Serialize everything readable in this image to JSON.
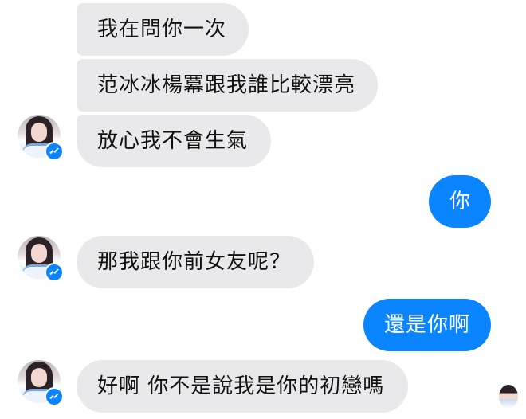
{
  "colors": {
    "incoming_bubble": "#e9e9eb",
    "outgoing_bubble": "#0a84ff",
    "messenger_badge": "#0a84ff"
  },
  "icons": {
    "messenger_badge": "messenger-icon"
  },
  "messages": [
    {
      "from": "them",
      "text": "我在問你一次"
    },
    {
      "from": "them",
      "text": "范冰冰楊冪跟我誰比較漂亮"
    },
    {
      "from": "them",
      "text": "放心我不會生氣"
    },
    {
      "from": "me",
      "text": "你"
    },
    {
      "from": "them",
      "text": "那我跟你前女友呢？"
    },
    {
      "from": "me",
      "text": "還是你啊"
    },
    {
      "from": "them",
      "text": "好啊 你不是說我是你的初戀嗎"
    }
  ]
}
